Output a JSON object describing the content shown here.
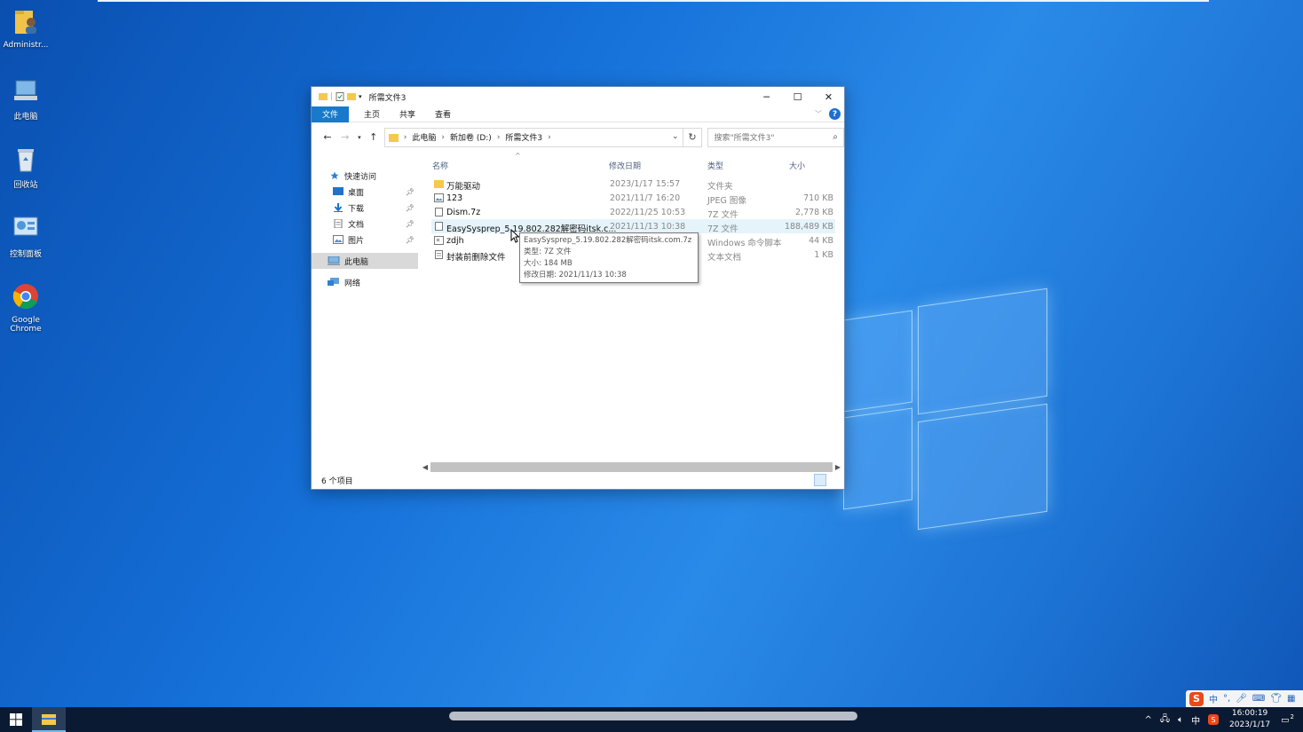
{
  "desktop": {
    "icons": [
      {
        "label": "Administr...",
        "icon": "user-folder-icon"
      },
      {
        "label": "此电脑",
        "icon": "computer-icon"
      },
      {
        "label": "回收站",
        "icon": "recycle-bin-icon"
      },
      {
        "label": "控制面板",
        "icon": "control-panel-icon"
      },
      {
        "label": "Google Chrome",
        "icon": "chrome-icon"
      }
    ]
  },
  "window": {
    "title": "所需文件3",
    "controls": {
      "minimize": "─",
      "maximize": "☐",
      "close": "✕"
    },
    "ribbon_tabs": [
      "文件",
      "主页",
      "共享",
      "查看"
    ],
    "help": "?",
    "address": {
      "segments": [
        "此电脑",
        "新加卷 (D:)",
        "所需文件3"
      ]
    },
    "search_placeholder": "搜索\"所需文件3\"",
    "nav_pane": {
      "quick_access": "快速访问",
      "items": [
        {
          "label": "桌面",
          "pinned": true
        },
        {
          "label": "下载",
          "pinned": true
        },
        {
          "label": "文档",
          "pinned": true
        },
        {
          "label": "图片",
          "pinned": true
        }
      ],
      "this_pc": "此电脑",
      "network": "网络"
    },
    "columns": {
      "name": "名称",
      "date": "修改日期",
      "type": "类型",
      "size": "大小"
    },
    "files": [
      {
        "name": "万能驱动",
        "date": "2023/1/17 15:57",
        "type": "文件夹",
        "size": "",
        "kind": "folder"
      },
      {
        "name": "123",
        "date": "2021/11/7 16:20",
        "type": "JPEG 图像",
        "size": "710 KB",
        "kind": "image"
      },
      {
        "name": "Dism.7z",
        "date": "2022/11/25 10:53",
        "type": "7Z 文件",
        "size": "2,778 KB",
        "kind": "file"
      },
      {
        "name": "EasySysprep_5.19.802.282解密码itsk.c...",
        "date": "2021/11/13 10:38",
        "type": "7Z 文件",
        "size": "188,489 KB",
        "kind": "file"
      },
      {
        "name": "zdjh",
        "date": "",
        "type": "Windows 命令脚本",
        "size": "44 KB",
        "kind": "script"
      },
      {
        "name": "封装前删除文件",
        "date": "",
        "type": "文本文档",
        "size": "1 KB",
        "kind": "text"
      }
    ],
    "tooltip": {
      "line1": "EasySysprep_5.19.802.282解密码itsk.com.7z",
      "line2": "类型: 7Z 文件",
      "line3": "大小: 184 MB",
      "line4": "修改日期: 2021/11/13 10:38"
    },
    "status": "6 个项目"
  },
  "ime": {
    "mode": "中",
    "punct": "°,"
  },
  "tray": {
    "lang": "中",
    "time": "16:00:19",
    "date": "2023/1/17",
    "notifications": "2"
  },
  "colors": {
    "accent": "#1979ca",
    "taskbar": "#0b1a33",
    "selection": "#e5f3fb"
  }
}
